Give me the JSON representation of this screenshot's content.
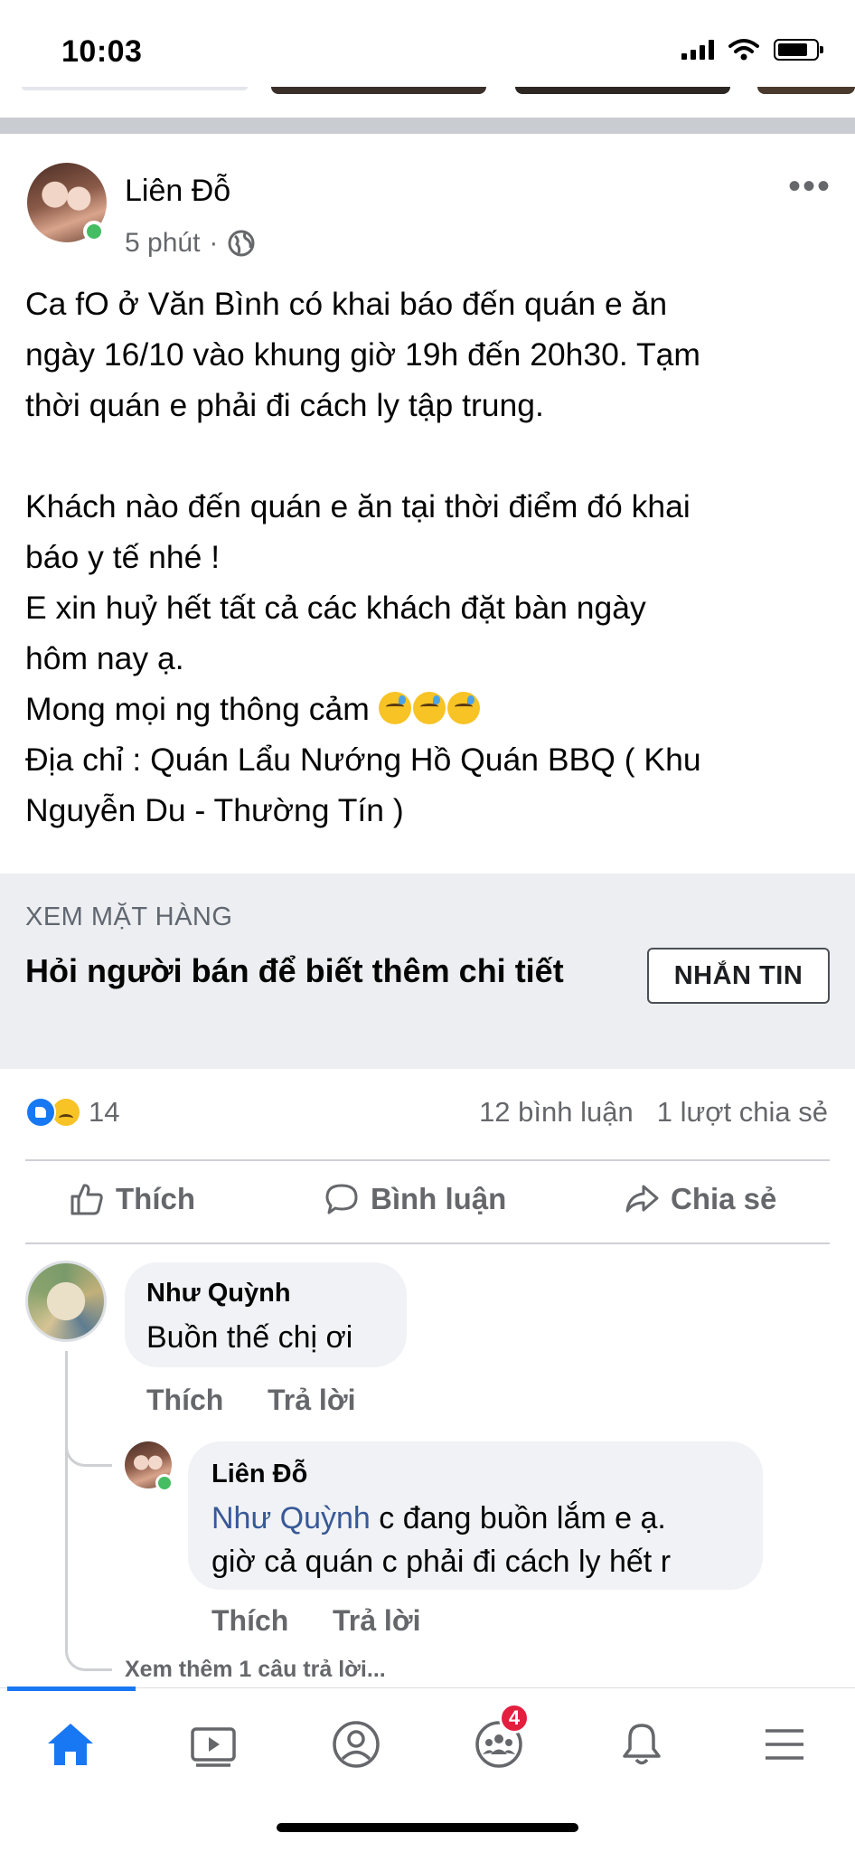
{
  "status_bar": {
    "time": "10:03"
  },
  "post": {
    "author": "Liên Đỗ",
    "time": "5 phút",
    "more_icon": "more-horizontal-icon",
    "privacy_icon": "globe-icon",
    "body_lines": [
      "Ca fO ở Văn Bình có khai báo đến quán e ăn",
      "ngày 16/10 vào khung giờ 19h đến 20h30. Tạm",
      "thời quán e phải đi cách ly tập trung.",
      "",
      "Khách nào đến quán e ăn tại thời điểm đó khai",
      "báo y tế nhé !",
      "E xin huỷ hết tất cả các khách đặt bàn ngày",
      "hôm nay ạ.",
      "Mong mọi ng thông cảm",
      "Địa chỉ : Quán Lẩu Nướng Hồ Quán BBQ ( Khu",
      "Nguyễn Du - Thường Tín )"
    ]
  },
  "marketplace": {
    "label": "XEM MẶT HÀNG",
    "title": "Hỏi người bán để biết thêm chi tiết",
    "button": "NHẮN TIN"
  },
  "stats": {
    "reaction_count": "14",
    "comments": "12 bình luận",
    "shares": "1 lượt chia sẻ"
  },
  "actions": {
    "like": "Thích",
    "comment": "Bình luận",
    "share": "Chia sẻ"
  },
  "comments": [
    {
      "author": "Như Quỳnh",
      "text": "Buồn thế chị ơi",
      "like": "Thích",
      "reply": "Trả lời"
    },
    {
      "author": "Liên Đỗ",
      "mention": "Như Quỳnh",
      "text_line1": " c đang buồn lắm e ạ.",
      "text_line2": "giờ cả quán c phải đi cách ly hết r",
      "like": "Thích",
      "reply": "Trả lời"
    }
  ],
  "see_more_replies": "Xem thêm 1 câu trả lời...",
  "bottom_nav": {
    "items": [
      "home-icon",
      "watch-icon",
      "profile-icon",
      "groups-icon",
      "notifications-icon",
      "menu-icon"
    ],
    "groups_badge": "4",
    "accent": "#1877f2"
  }
}
